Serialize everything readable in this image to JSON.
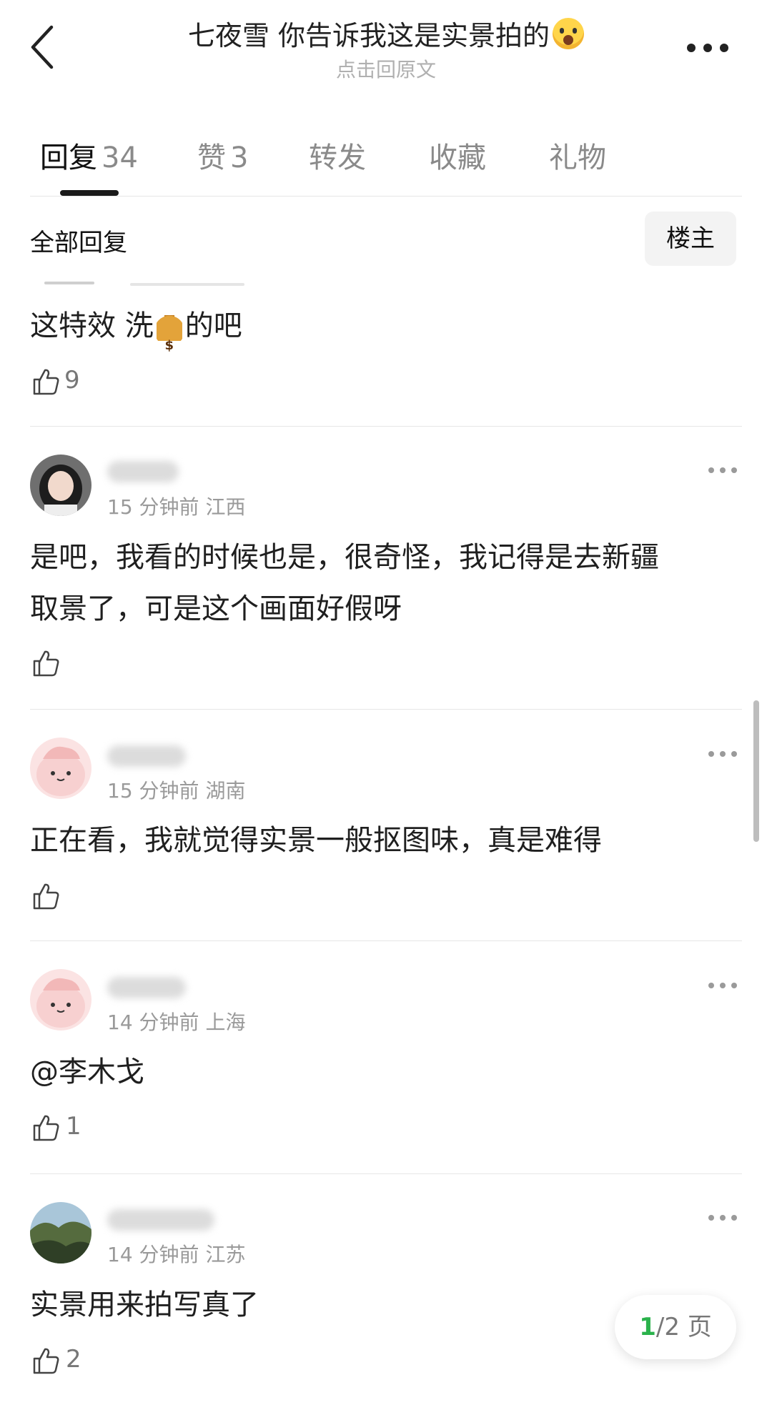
{
  "header": {
    "title": "七夜雪 你告诉我这是实景拍的",
    "title_emoji": "face-screaming-in-fear-emoji",
    "subtitle": "点击回原文"
  },
  "tabs": [
    {
      "label": "回复",
      "count": "34",
      "active": true
    },
    {
      "label": "赞",
      "count": "3",
      "active": false
    },
    {
      "label": "转发",
      "count": "",
      "active": false
    },
    {
      "label": "收藏",
      "count": "",
      "active": false
    },
    {
      "label": "礼物",
      "count": "",
      "active": false
    }
  ],
  "section": {
    "title": "全部回复",
    "filter_label": "楼主"
  },
  "comments": [
    {
      "text_before": "这特效 洗",
      "emoji": "money-bag-emoji",
      "text_after": "的吧",
      "likes": "9"
    },
    {
      "time": "15 分钟前",
      "location": "江西",
      "text_line1": "是吧，我看的时候也是，很奇怪，我记得是去新疆",
      "text_line2": "取景了，可是这个画面好假呀",
      "likes": ""
    },
    {
      "time": "15 分钟前",
      "location": "湖南",
      "text": "正在看，我就觉得实景一般抠图味，真是难得",
      "likes": ""
    },
    {
      "time": "14 分钟前",
      "location": "上海",
      "text": "@李木戈",
      "likes": "1"
    },
    {
      "time": "14 分钟前",
      "location": "江苏",
      "text": "实景用来拍写真了",
      "likes": "2"
    }
  ],
  "pagination": {
    "current": "1",
    "total": "/2 页"
  },
  "colors": {
    "accent_green": "#2ab24b",
    "text": "#1f1f1f",
    "muted": "#9a9a9a"
  }
}
